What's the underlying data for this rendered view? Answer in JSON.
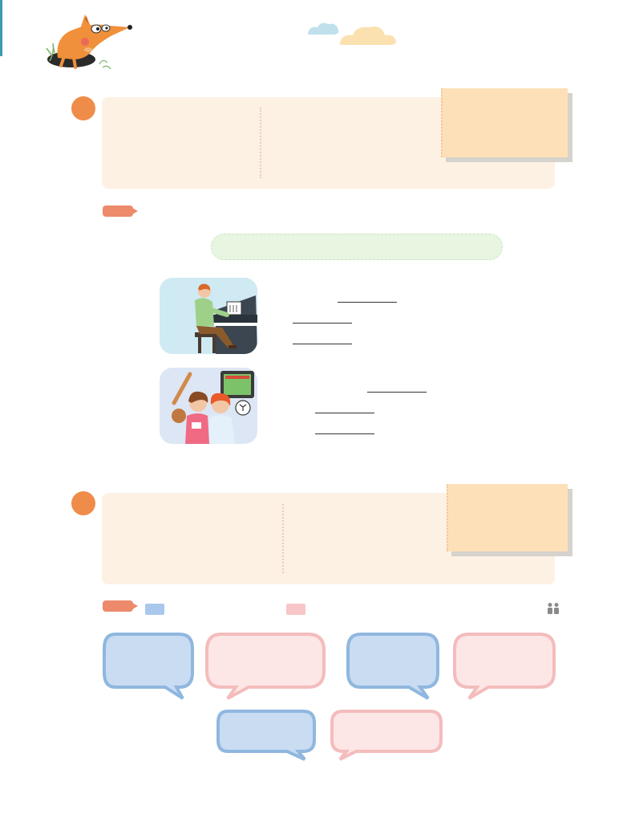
{
  "page": {
    "title": "",
    "section_numbers": [
      "",
      ""
    ],
    "labels": []
  },
  "colors": {
    "accent_orange": "#f08c4a",
    "tag_coral": "#ec8a6b",
    "panel_cream": "#fdf1e4",
    "sticky_peach": "#fde0b8",
    "green_bar": "#e7f5e1",
    "bubble_blue": "#c9dcf2",
    "bubble_pink": "#fde6e6"
  },
  "icons": {
    "mascot": "fox-in-hole-icon",
    "clouds": "cloud-icon",
    "pair_work": "pair-work-icon"
  },
  "images": [
    {
      "name": "piano-player-illustration"
    },
    {
      "name": "girls-with-sports-items-illustration"
    }
  ]
}
